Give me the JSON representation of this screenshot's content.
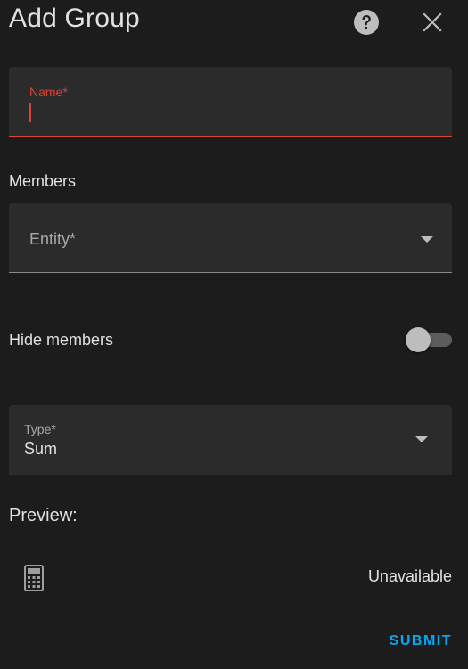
{
  "dialog": {
    "title": "Add Group",
    "help_icon": "help-circle-icon",
    "close_icon": "close-icon"
  },
  "form": {
    "name": {
      "label": "Name*",
      "value": ""
    },
    "members": {
      "label": "Members",
      "entity_label": "Entity*"
    },
    "hide_members": {
      "label": "Hide members",
      "enabled": false
    },
    "type": {
      "label": "Type*",
      "value": "Sum"
    }
  },
  "preview": {
    "label": "Preview:",
    "icon": "calculator-icon",
    "state": "Unavailable"
  },
  "actions": {
    "submit_label": "SUBMIT"
  },
  "colors": {
    "background": "#1c1c1c",
    "field_bg": "#2b2b2b",
    "error": "#db4437",
    "accent": "#03a9f4"
  }
}
